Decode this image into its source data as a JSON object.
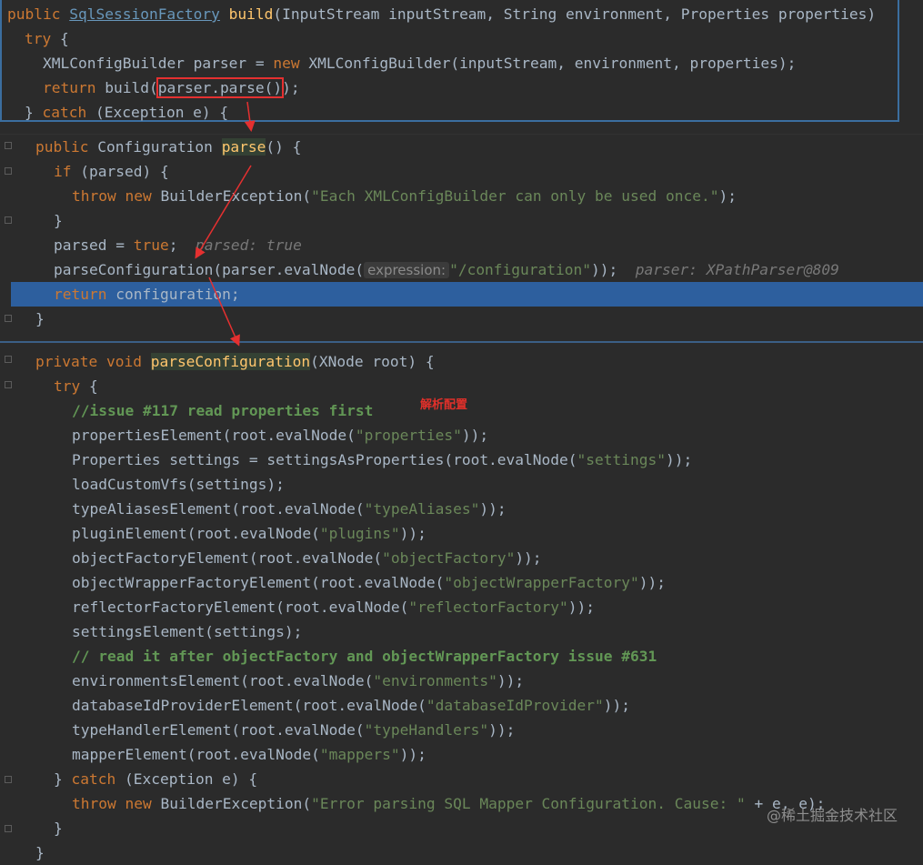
{
  "panel1": {
    "line1": {
      "kw": "public ",
      "type": "SqlSessionFactory",
      "fn": "build",
      "rest": "(InputStream inputStream, String environment, Properties properties)"
    },
    "line2": {
      "kw": "try",
      "rest": " {"
    },
    "line3": {
      "a": "XMLConfigBuilder parser = ",
      "kw": "new",
      "b": " XMLConfigBuilder(inputStream, environment, properties);"
    },
    "line4": {
      "kw": "return",
      "a": " build(",
      "box": "parser.parse()",
      "b": ");"
    },
    "line5": {
      "a": "} ",
      "kw": "catch",
      "b": " (Exception e) {"
    }
  },
  "panel2": {
    "line1": {
      "kw": "public ",
      "a": "Configuration ",
      "fn": "parse",
      "b": "() {"
    },
    "line2": {
      "kw": "if",
      "a": " (parsed) {"
    },
    "line3": {
      "kw1": "throw ",
      "kw2": "new",
      "a": " BuilderException(",
      "str": "\"Each XMLConfigBuilder can only be used once.\"",
      "b": ");"
    },
    "line4": {
      "a": "}"
    },
    "line5": {
      "a": "parsed = ",
      "kw": "true",
      "b": ";",
      "hint": "parsed: true"
    },
    "line6": {
      "a": "parseConfiguration(parser.evalNode(",
      "inlay": "expression:",
      "str": "\"/configuration\"",
      "b": "));",
      "hint": "parser: XPathParser@809"
    },
    "line7": {
      "kw": "return",
      "a": " configuration;"
    },
    "line8": {
      "a": "}"
    }
  },
  "panel3": {
    "line1": {
      "kw": "private void ",
      "fn": "parseConfiguration",
      "a": "(XNode root) {"
    },
    "line2": {
      "kw": "try",
      "a": " {"
    },
    "comment1": "//issue #117 read properties first",
    "annotation": "解析配置",
    "calls": [
      {
        "fn": "propertiesElement",
        "arg": "\"properties\""
      },
      {
        "pre": "Properties settings = ",
        "fn": "settingsAsProperties",
        "arg": "\"settings\""
      },
      {
        "fn": "loadCustomVfs",
        "plain": "settings"
      },
      {
        "fn": "typeAliasesElement",
        "arg": "\"typeAliases\""
      },
      {
        "fn": "pluginElement",
        "arg": "\"plugins\""
      },
      {
        "fn": "objectFactoryElement",
        "arg": "\"objectFactory\""
      },
      {
        "fn": "objectWrapperFactoryElement",
        "arg": "\"objectWrapperFactory\""
      },
      {
        "fn": "reflectorFactoryElement",
        "arg": "\"reflectorFactory\""
      },
      {
        "fn": "settingsElement",
        "plain": "settings"
      }
    ],
    "comment2": "// read it after objectFactory and objectWrapperFactory issue #631",
    "calls2": [
      {
        "fn": "environmentsElement",
        "arg": "\"environments\""
      },
      {
        "fn": "databaseIdProviderElement",
        "arg": "\"databaseIdProvider\""
      },
      {
        "fn": "typeHandlerElement",
        "arg": "\"typeHandlers\""
      },
      {
        "fn": "mapperElement",
        "arg": "\"mappers\""
      }
    ],
    "catch": {
      "a": "} ",
      "kw": "catch",
      "b": " (Exception e) {"
    },
    "throw": {
      "kw1": "throw ",
      "kw2": "new",
      "a": " BuilderException(",
      "str": "\"Error parsing SQL Mapper Configuration. Cause: \"",
      "b": " + e, e);"
    },
    "close1": "}",
    "close2": "}"
  },
  "watermark": "@稀土掘金技术社区",
  "colors": {
    "keyword": "#cc7832",
    "function": "#ffc66d",
    "string": "#6a8759",
    "comment": "#629755",
    "selection": "#2d5f9e",
    "arrow": "#e53030"
  }
}
